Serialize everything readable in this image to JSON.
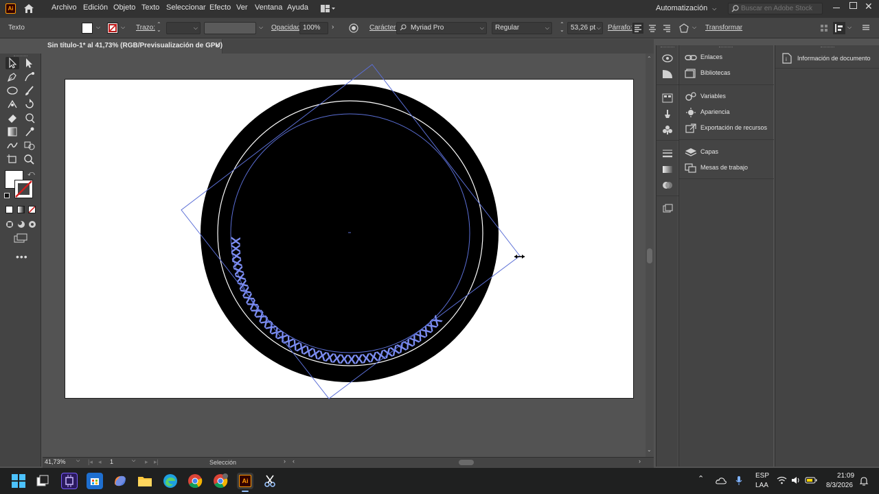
{
  "menubar": {
    "app_badge": "Ai",
    "items": [
      "Archivo",
      "Edición",
      "Objeto",
      "Texto",
      "Seleccionar",
      "Efecto",
      "Ver",
      "Ventana",
      "Ayuda"
    ],
    "workspace": "Automatización",
    "search_placeholder": "Buscar en Adobe Stock"
  },
  "controlbar": {
    "selection_type": "Texto",
    "stroke_label": "Trazo:",
    "opacity_label": "Opacidad:",
    "opacity_value": "100%",
    "character_label": "Carácter:",
    "font_family": "Myriad Pro",
    "font_style": "Regular",
    "font_size": "53,26 pt",
    "paragraph_label": "Párrafo:",
    "transform_label": "Transformar"
  },
  "document": {
    "tab_title": "Sin título-1* al 41,73% (RGB/Previsualización de GPU)",
    "close_symbol": "×"
  },
  "statusbar": {
    "zoom": "41,73%",
    "artboard_number": "1",
    "tool_status": "Selección"
  },
  "panels": {
    "group1": [
      {
        "label": "Enlaces",
        "icon": "links-icon"
      },
      {
        "label": "Bibliotecas",
        "icon": "libraries-icon"
      }
    ],
    "group2": [
      {
        "label": "Variables",
        "icon": "variables-icon"
      },
      {
        "label": "Apariencia",
        "icon": "appearance-icon"
      },
      {
        "label": "Exportación de recursos",
        "icon": "asset-export-icon"
      }
    ],
    "group3": [
      {
        "label": "Capas",
        "icon": "layers-icon"
      },
      {
        "label": "Mesas de trabajo",
        "icon": "artboards-icon"
      }
    ],
    "info_panel": "Información de documento"
  },
  "taskbar": {
    "language_top": "ESP",
    "language_bottom": "LAA",
    "time": "21:09",
    "date": "8/3/2026"
  },
  "canvas": {
    "path_text": "XXXXXXXXXXXXXXXXXXXXXXXXXXXXXXXXXXXXXXX"
  },
  "colors": {
    "accent_selection": "#5b6fd6",
    "ai_orange": "#ff9a00",
    "ai_dark": "#330000"
  }
}
